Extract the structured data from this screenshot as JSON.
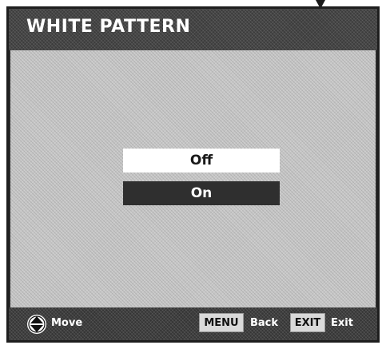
{
  "osd": {
    "title": "WHITE PATTERN",
    "options": [
      {
        "label": "Off",
        "highlighted": true
      },
      {
        "label": "On",
        "highlighted": false
      }
    ]
  },
  "footer": {
    "move_icon": "up-down-arrow-icon",
    "move_label": "Move",
    "menu_key": "MENU",
    "back_label": "Back",
    "exit_key": "EXIT",
    "exit_label": "Exit"
  },
  "colors": {
    "header_bg": "#3c3c3c",
    "body_bg": "#c6c6c6",
    "highlight_bg": "#ffffff",
    "selected_bg": "#2f2f2f",
    "footer_key_bg": "#d9d9d9"
  }
}
